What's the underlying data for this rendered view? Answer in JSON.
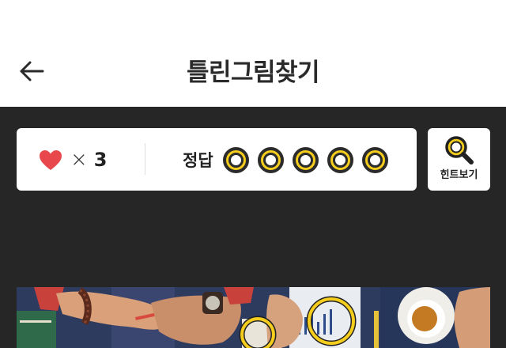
{
  "header": {
    "title": "틀린그림찾기",
    "back_icon": "arrow-left-icon"
  },
  "status": {
    "lives_icon": "heart-icon",
    "lives_color": "#e8474c",
    "times_symbol": "×",
    "lives_count": "3",
    "answers_label": "정답",
    "answer_slots": 5,
    "answers_found": 0,
    "ring_color": "#f5cd1c"
  },
  "hint": {
    "icon": "magnifier-icon",
    "label": "힌트보기"
  },
  "puzzle": {
    "image": "spot-the-difference-photo",
    "found_markers": 2
  }
}
